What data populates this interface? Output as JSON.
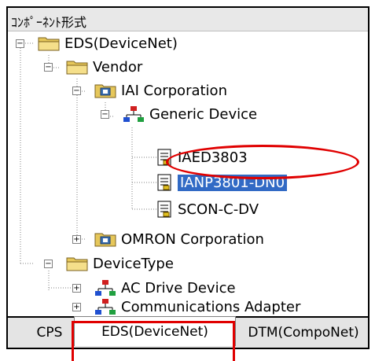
{
  "header": {
    "label": "ｺﾝﾎﾟｰﾈﾝﾄ形式"
  },
  "tree": {
    "nodes": [
      {
        "label": "EDS(DeviceNet)"
      },
      {
        "label": "Vendor"
      },
      {
        "label": "IAI Corporation"
      },
      {
        "label": "Generic Device"
      },
      {
        "label": "IAED3803"
      },
      {
        "label": "IANP3801-DN0"
      },
      {
        "label": "SCON-C-DV"
      },
      {
        "label": "OMRON Corporation"
      },
      {
        "label": "DeviceType"
      },
      {
        "label": "AC Drive Device"
      },
      {
        "label": "Communications Adapter"
      }
    ]
  },
  "tabs": [
    {
      "label": "CPS"
    },
    {
      "label": "EDS(DeviceNet)"
    },
    {
      "label": "DTM(CompoNet)"
    }
  ],
  "colors": {
    "highlight": "#316ac5",
    "annotation": "#e00000",
    "folder": "#e6c75a",
    "vendor_icon": "#3a6fb0"
  }
}
